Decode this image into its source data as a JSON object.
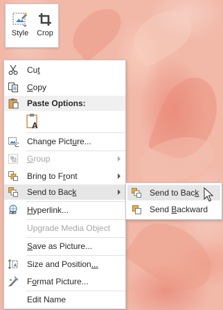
{
  "mini_toolbar": {
    "style_label": "Style",
    "crop_label": "Crop"
  },
  "context_menu": {
    "cut": {
      "label_pre": "Cu",
      "label_acc": "t",
      "label_post": "",
      "icon": "scissors-icon"
    },
    "copy": {
      "label_pre": "",
      "label_acc": "C",
      "label_post": "opy",
      "icon": "copy-icon"
    },
    "paste_options_header": "Paste Options:",
    "paste_option_icon": "paste-keep-text-only-icon",
    "change_picture": {
      "label_pre": "Change Pict",
      "label_acc": "u",
      "label_post": "re...",
      "icon": "change-picture-icon"
    },
    "group": {
      "label_pre": "",
      "label_acc": "G",
      "label_post": "roup",
      "icon": "group-icon",
      "disabled": true
    },
    "bring_to_front": {
      "label_pre": "Bring to F",
      "label_acc": "r",
      "label_post": "ont",
      "icon": "bring-to-front-icon"
    },
    "send_to_back": {
      "label_pre": "Send to Bac",
      "label_acc": "k",
      "label_post": "",
      "icon": "send-to-back-icon",
      "highlighted": true
    },
    "hyperlink": {
      "label_pre": "",
      "label_acc": "H",
      "label_post": "yperlink...",
      "icon": "hyperlink-icon"
    },
    "upgrade_media_object": {
      "label": "Upgrade Media Object",
      "disabled": true
    },
    "save_as_picture": {
      "label_pre": "",
      "label_acc": "S",
      "label_post": "ave as Picture..."
    },
    "size_and_position": {
      "label_pre": "Size and Position",
      "label_acc": "...",
      "label_post": "",
      "icon": "size-position-icon"
    },
    "format_picture": {
      "label_pre": "F",
      "label_acc": "o",
      "label_post": "rmat Picture...",
      "icon": "format-picture-icon"
    },
    "edit_name": {
      "label": "Edit Name"
    }
  },
  "submenu": {
    "send_to_back": {
      "label_pre": "Send to Bac",
      "label_acc": "k",
      "label_post": "",
      "highlighted": true
    },
    "send_backward": {
      "label_pre": "Send ",
      "label_acc": "B",
      "label_post": "ackward"
    }
  },
  "colors": {
    "highlight": "#e6e6e6",
    "disabled_text": "#a6a6a6",
    "menu_border": "#c6c6c6",
    "background": "#f2b8a8"
  }
}
